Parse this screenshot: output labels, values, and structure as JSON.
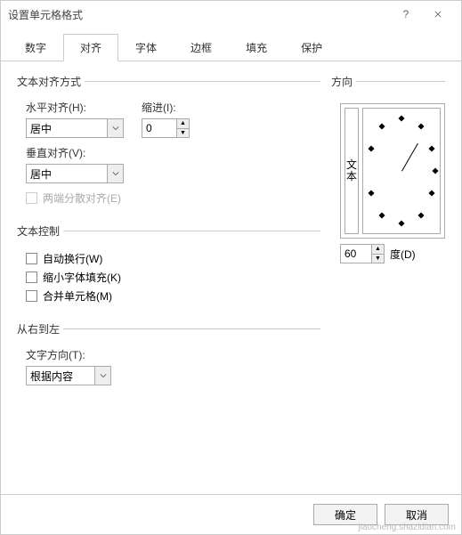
{
  "window": {
    "title": "设置单元格格式"
  },
  "tabs": [
    "数字",
    "对齐",
    "字体",
    "边框",
    "填充",
    "保护"
  ],
  "active_tab": 1,
  "align": {
    "group": "文本对齐方式",
    "h_label": "水平对齐(H):",
    "h_value": "居中",
    "indent_label": "缩进(I):",
    "indent_value": "0",
    "v_label": "垂直对齐(V):",
    "v_value": "居中",
    "justify_label": "两端分散对齐(E)"
  },
  "text_control": {
    "group": "文本控制",
    "wrap": "自动换行(W)",
    "shrink": "缩小字体填充(K)",
    "merge": "合并单元格(M)"
  },
  "rtl": {
    "group": "从右到左",
    "dir_label": "文字方向(T):",
    "dir_value": "根据内容"
  },
  "orient": {
    "group": "方向",
    "vtext1": "文",
    "vtext2": "本",
    "deg_value": "60",
    "deg_label": "度(D)"
  },
  "buttons": {
    "ok": "确定",
    "cancel": "取消"
  },
  "watermark": "jiaocheng.shazidian.com"
}
